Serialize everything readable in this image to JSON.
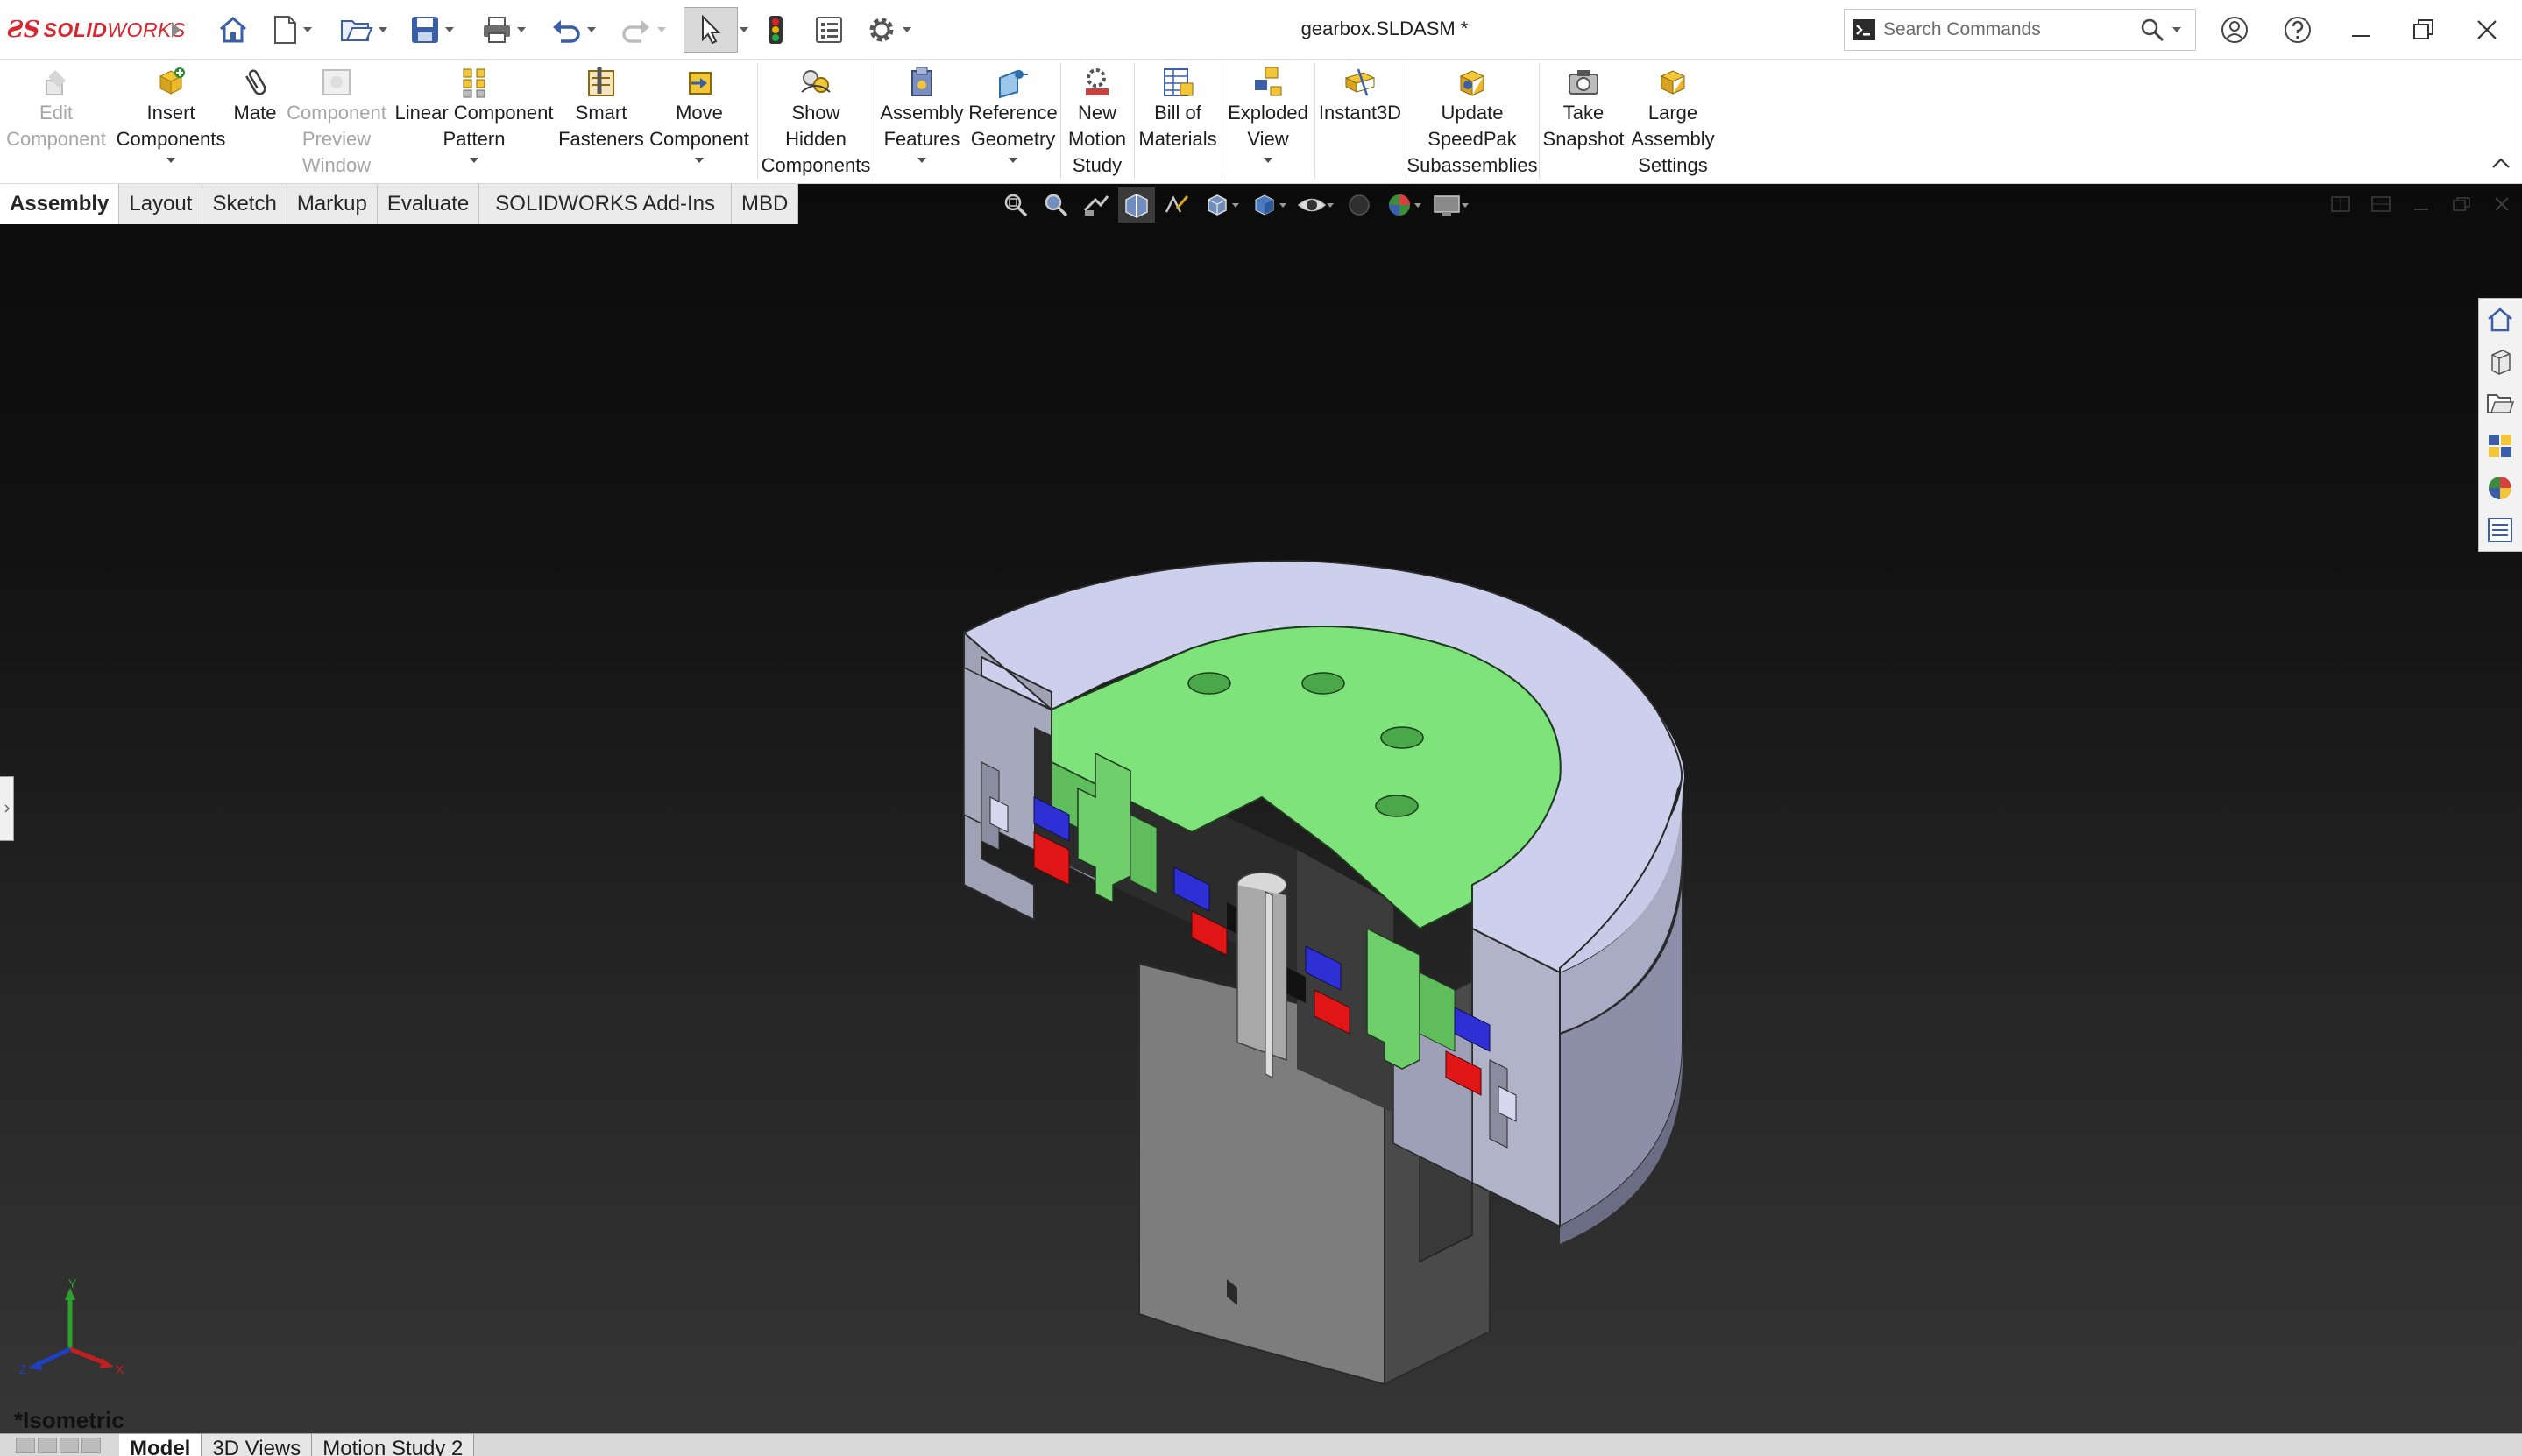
{
  "app": {
    "brand_prefix": "ƧS",
    "brand_bold": "SOLID",
    "brand_rest": "WORKS",
    "document_title": "gearbox.SLDASM *"
  },
  "search": {
    "placeholder": "Search Commands"
  },
  "quick_access": [
    {
      "icon": "home-icon"
    },
    {
      "icon": "new-document-icon"
    },
    {
      "icon": "open-icon"
    },
    {
      "icon": "save-icon"
    },
    {
      "icon": "print-icon"
    },
    {
      "icon": "undo-icon"
    },
    {
      "icon": "redo-icon"
    },
    {
      "icon": "select-arrow-icon"
    },
    {
      "icon": "rebuild-traffic-light-icon"
    },
    {
      "icon": "file-properties-icon"
    },
    {
      "icon": "options-gear-icon"
    }
  ],
  "ribbon": {
    "edit_component": "Edit\nComponent",
    "insert_components": "Insert\nComponents",
    "mate": "Mate",
    "component_preview": "Component\nPreview\nWindow",
    "linear_pattern": "Linear Component\nPattern",
    "smart_fasteners": "Smart\nFasteners",
    "move_component": "Move\nComponent",
    "show_hidden": "Show\nHidden\nComponents",
    "assembly_features": "Assembly\nFeatures",
    "reference_geometry": "Reference\nGeometry",
    "new_motion_study": "New\nMotion\nStudy",
    "bill_of_materials": "Bill of\nMaterials",
    "exploded_view": "Exploded\nView",
    "instant3d": "Instant3D",
    "update_speedpak": "Update\nSpeedPak\nSubassemblies",
    "take_snapshot": "Take\nSnapshot",
    "large_assembly": "Large\nAssembly\nSettings"
  },
  "tabs": [
    "Assembly",
    "Layout",
    "Sketch",
    "Markup",
    "Evaluate",
    "SOLIDWORKS Add-Ins",
    "MBD"
  ],
  "active_tab": "Assembly",
  "view": {
    "orientation": "*Isometric"
  },
  "triad": {
    "x": "X",
    "y": "Y",
    "z": "Z"
  },
  "bottom_tabs": [
    "Model",
    "3D Views",
    "Motion Study 2"
  ],
  "active_bottom_tab": "Model",
  "colors": {
    "brand_red": "#d7262f",
    "housing": "#c8cbe8",
    "carrier_green": "#7ee37a",
    "magnet_blue": "#2f2fd6",
    "magnet_red": "#e01515"
  }
}
